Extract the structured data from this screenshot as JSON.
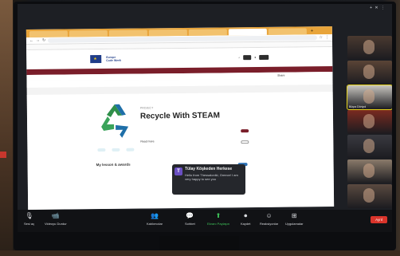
{
  "zoom": {
    "corner_text": "+ ✕ ⋮"
  },
  "browser": {
    "tabs": [
      "",
      "",
      "",
      "",
      "",
      "",
      ""
    ],
    "url": "",
    "bookmarks": [
      "",
      "",
      "",
      "",
      "",
      "",
      "",
      "",
      "",
      "",
      "",
      "",
      "",
      ""
    ]
  },
  "site": {
    "logo_text": "Europe\nCode Week",
    "nav_items": [
      "",
      "",
      "",
      "",
      "",
      ""
    ],
    "crumbs": "",
    "share_label": "Share",
    "project_label": "PROJECT",
    "project_title": "Recycle With STEAM",
    "description": "",
    "more_label": "Read more",
    "pills": [
      "",
      "",
      ""
    ],
    "side_lines": [
      "",
      "",
      "",
      ""
    ],
    "side_button": "",
    "side_button2": "",
    "section_title": "My lesson & awards",
    "blue_button": ""
  },
  "chat": {
    "avatar_letter": "T",
    "sender": "Tülay Köşkeden Herkese",
    "message": "Hello from Thessaloniki, Greece! I am very happy to see you"
  },
  "participants": [
    {
      "name": "",
      "color": "#4a3a30",
      "speaker": false
    },
    {
      "name": "",
      "color": "#5a4436",
      "speaker": false
    },
    {
      "name": "Büşra Dörtyol",
      "color": "#c8c6c0",
      "speaker": true
    },
    {
      "name": "",
      "color": "#7a2a20",
      "speaker": false
    },
    {
      "name": "",
      "color": "#3a3a40",
      "speaker": false
    },
    {
      "name": "",
      "color": "#8a7a6a",
      "speaker": false
    },
    {
      "name": "",
      "color": "#5a4a40",
      "speaker": false
    }
  ],
  "toolbar": {
    "items": [
      {
        "label": "Sesi aç",
        "icon": "🎙"
      },
      {
        "label": "Videoyu Durdur",
        "icon": "📹"
      },
      {
        "label": "Katılımcılar",
        "icon": "👥"
      },
      {
        "label": "Sohbet",
        "icon": "💬"
      },
      {
        "label": "Ekranı Paylaşın",
        "icon": "⬆"
      },
      {
        "label": "Kaydet",
        "icon": "⏺"
      },
      {
        "label": "Reaksiyonlar",
        "icon": "☺"
      },
      {
        "label": "Uygulamalar",
        "icon": "⊞"
      }
    ],
    "leave_label": "Ayrıl"
  },
  "colors": {
    "toolbar_bg": "#111215",
    "share_green": "#3ec45a",
    "leave_red": "#d9342b",
    "site_nav": "#7a1e2a",
    "tab_orange": "#e8a43a",
    "speaker_yellow": "#e5d21b"
  }
}
